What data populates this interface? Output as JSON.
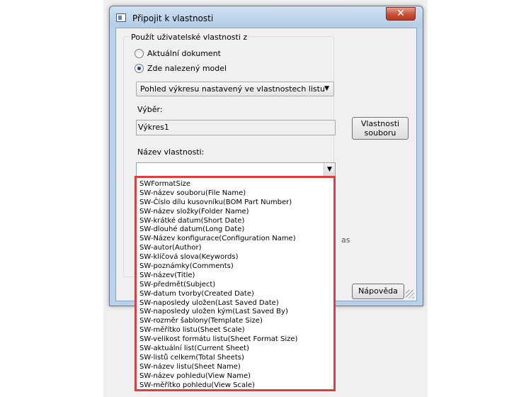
{
  "dialog": {
    "title": "Připojit k vlastnosti",
    "close_symbol": "✕",
    "group_label": "Použít uživatelské vlastnosti z",
    "radios": [
      {
        "label": "Aktuální dokument",
        "checked": false
      },
      {
        "label": "Zde nalezený model",
        "checked": true
      }
    ],
    "view_combo": "Pohled výkresu nastavený ve vlastnostech listu",
    "selection_label": "Výběr:",
    "selection_value": "Výkres1",
    "property_label": "Název vlastnosti:",
    "file_properties_button": [
      "Vlastnosti",
      "souboru"
    ],
    "help_button": "Nápověda",
    "partial_text": "as"
  },
  "dropdown_items": [
    "SWFormatSize",
    "SW-název souboru(File Name)",
    "SW-Číslo dílu kusovníku(BOM Part Number)",
    "SW-název složky(Folder Name)",
    "SW-krátké datum(Short Date)",
    "SW-dlouhé datum(Long Date)",
    "SW-Název konfigurace(Configuration Name)",
    "SW-autor(Author)",
    "SW-klíčová slova(Keywords)",
    "SW-poznámky(Comments)",
    "SW-název(Title)",
    "SW-předmět(Subject)",
    "SW-datum tvorby(Created Date)",
    "SW-naposledy uložen(Last Saved Date)",
    "SW-naposledy uložen kým(Last Saved By)",
    "SW-rozměr šablony(Template Size)",
    "SW-měřítko listu(Sheet Scale)",
    "SW-velikost formátu listu(Sheet Format Size)",
    "SW-aktuální list(Current Sheet)",
    "SW-listů celkem(Total Sheets)",
    "SW-název listu(Sheet Name)",
    "SW-název pohledu(View Name)",
    "SW-měřítko pohledu(View Scale)"
  ],
  "colors": {
    "highlight_border": "#dd3f3f",
    "titlebar": "#b9d1ea"
  }
}
